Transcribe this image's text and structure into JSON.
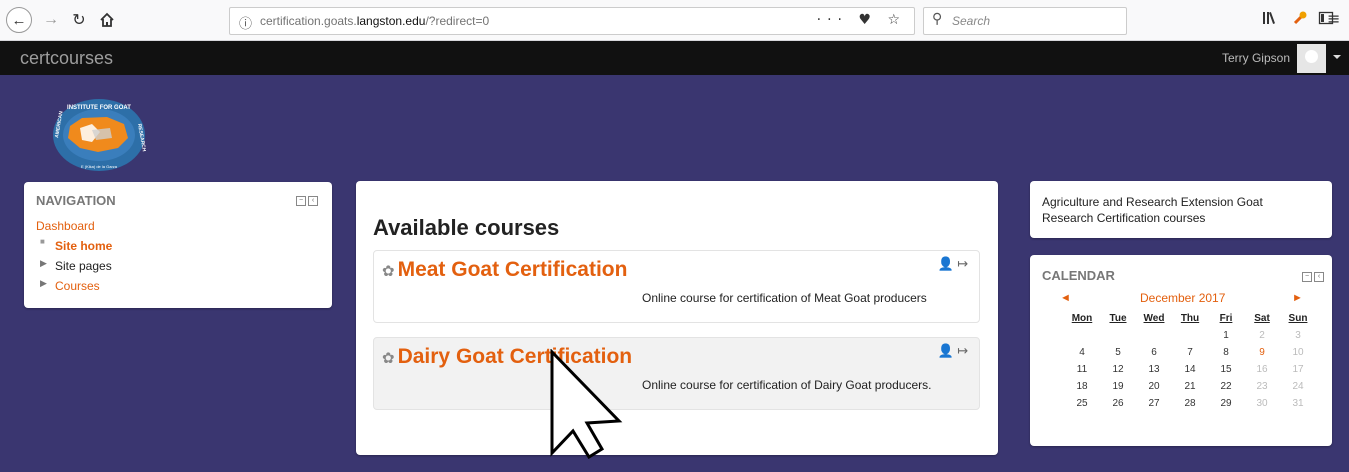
{
  "browser": {
    "url_prefix": "certification.goats.",
    "url_domain": "langston.edu",
    "url_suffix": "/?redirect=0",
    "page_actions": "··· ♥ ☆",
    "search_placeholder": "Search"
  },
  "site": {
    "name": "certcourses",
    "user_name": "Terry Gipson",
    "logo_text_top": "INSTITUTE FOR GOAT",
    "logo_text_left": "AMERICAN",
    "logo_text_right": "RESEARCH",
    "logo_text_bottom": "E (Kika) de la Garza"
  },
  "navigation": {
    "title": "NAVIGATION",
    "dashboard": "Dashboard",
    "site_home": "Site home",
    "site_pages": "Site pages",
    "courses": "Courses"
  },
  "main": {
    "heading": "Available courses",
    "courses": [
      {
        "title": "Meat Goat Certification",
        "desc": "Online course for certification of Meat Goat producers"
      },
      {
        "title": "Dairy Goat Certification",
        "desc": "Online course for certification of Dairy Goat producers."
      }
    ]
  },
  "info": {
    "text": "Agriculture and Research Extension Goat Research Certification courses"
  },
  "calendar": {
    "title": "CALENDAR",
    "month": "December 2017",
    "prev": "◄",
    "next": "►",
    "days": [
      "Mon",
      "Tue",
      "Wed",
      "Thu",
      "Fri",
      "Sat",
      "Sun"
    ],
    "weeks": [
      [
        "",
        "",
        "",
        "",
        "1",
        "2",
        "3"
      ],
      [
        "4",
        "5",
        "6",
        "7",
        "8",
        "9",
        "10"
      ],
      [
        "11",
        "12",
        "13",
        "14",
        "15",
        "16",
        "17"
      ],
      [
        "18",
        "19",
        "20",
        "21",
        "22",
        "23",
        "24"
      ],
      [
        "25",
        "26",
        "27",
        "28",
        "29",
        "30",
        "31"
      ]
    ],
    "today": "9",
    "accent_color": "#e3600f"
  },
  "colors": {
    "background": "#3a3670",
    "navbar": "#111111",
    "link": "#e3600f"
  }
}
